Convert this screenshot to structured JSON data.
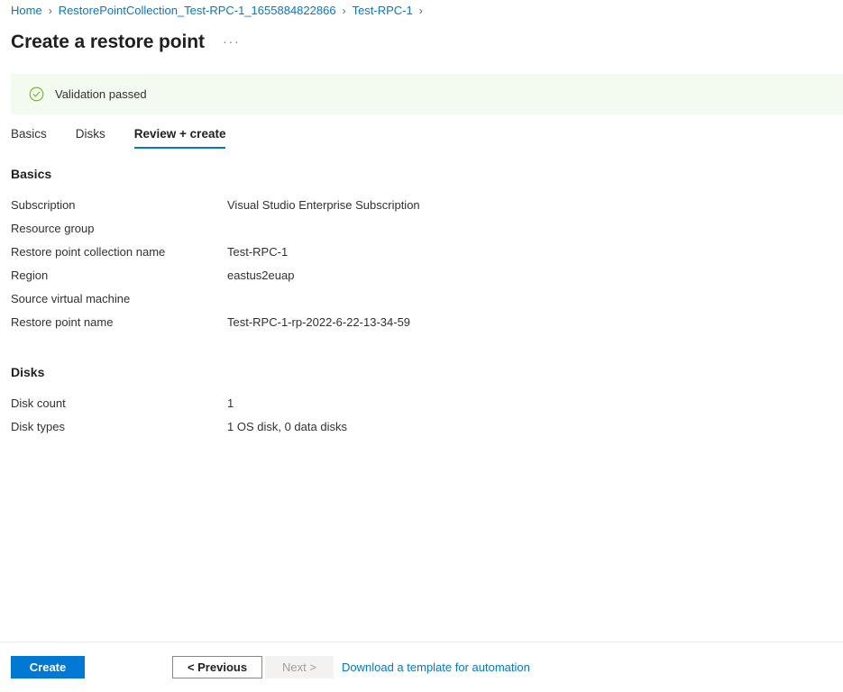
{
  "breadcrumb": {
    "separator": "›",
    "items": [
      {
        "label": "Home"
      },
      {
        "label": "RestorePointCollection_Test-RPC-1_1655884822866"
      },
      {
        "label": "Test-RPC-1"
      }
    ],
    "trailing_separator": "›"
  },
  "header": {
    "title": "Create a restore point",
    "more_menu": "···"
  },
  "banner": {
    "icon": "check-circle-icon",
    "text": "Validation passed",
    "accent_color": "#6bb700",
    "background_color": "#f3faef"
  },
  "tabs": [
    {
      "label": "Basics",
      "active": false
    },
    {
      "label": "Disks",
      "active": false
    },
    {
      "label": "Review + create",
      "active": true
    }
  ],
  "sections": [
    {
      "heading": "Basics",
      "rows": [
        {
          "key": "Subscription",
          "value": "Visual Studio Enterprise Subscription"
        },
        {
          "key": "Resource group",
          "value": ""
        },
        {
          "key": "Restore point collection name",
          "value": "Test-RPC-1"
        },
        {
          "key": "Region",
          "value": "eastus2euap"
        },
        {
          "key": "Source virtual machine",
          "value": ""
        },
        {
          "key": "Restore point name",
          "value": "Test-RPC-1-rp-2022-6-22-13-34-59"
        }
      ]
    },
    {
      "heading": "Disks",
      "rows": [
        {
          "key": "Disk count",
          "value": "1"
        },
        {
          "key": "Disk types",
          "value": "1 OS disk, 0 data disks"
        }
      ]
    }
  ],
  "footer": {
    "create_label": "Create",
    "previous_label": "< Previous",
    "next_label": "Next >",
    "download_template_label": "Download a template for automation",
    "accent_color": "#0078d4"
  }
}
